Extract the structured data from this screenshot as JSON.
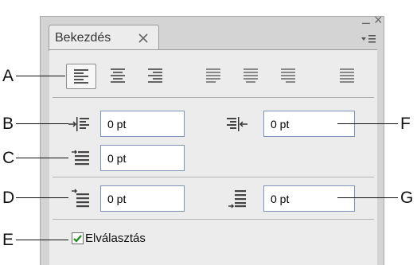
{
  "panel": {
    "tab_label": "Bekezdés",
    "tab_close_icon": "close-icon",
    "minimize_glyph": "–",
    "close_glyph": "×",
    "menu_icon": "panel-menu-icon"
  },
  "callouts": [
    "A",
    "B",
    "C",
    "D",
    "E",
    "F",
    "G"
  ],
  "alignment": {
    "selected": "align-left",
    "buttons": [
      "align-left",
      "align-center",
      "align-right",
      "justify-last-left",
      "justify-last-center",
      "justify-last-right",
      "justify-all"
    ]
  },
  "fields": {
    "left_indent": "0 pt",
    "right_indent": "0 pt",
    "first_line_indent": "0 pt",
    "space_before": "0 pt",
    "space_after": "0 pt"
  },
  "hyphenate": {
    "label": "Elválasztás",
    "checked": true,
    "check_color": "#1a8a1a"
  }
}
